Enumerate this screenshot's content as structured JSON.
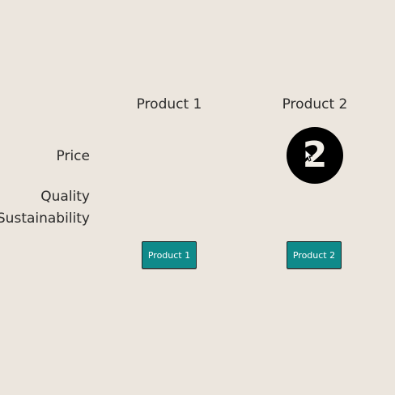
{
  "columns": {
    "product1": "Product 1",
    "product2": "Product 2"
  },
  "rows": {
    "price": "Price",
    "quality": "Quality",
    "sustainability": "Sustainability"
  },
  "badge": {
    "value": "2"
  },
  "buttons": {
    "product1": "Product 1",
    "product2": "Product 2"
  },
  "colors": {
    "background": "#ece6de",
    "button": "#0f8a8a",
    "badge": "#000000"
  },
  "icons": {
    "cursor": "mouse-pointer-icon"
  }
}
